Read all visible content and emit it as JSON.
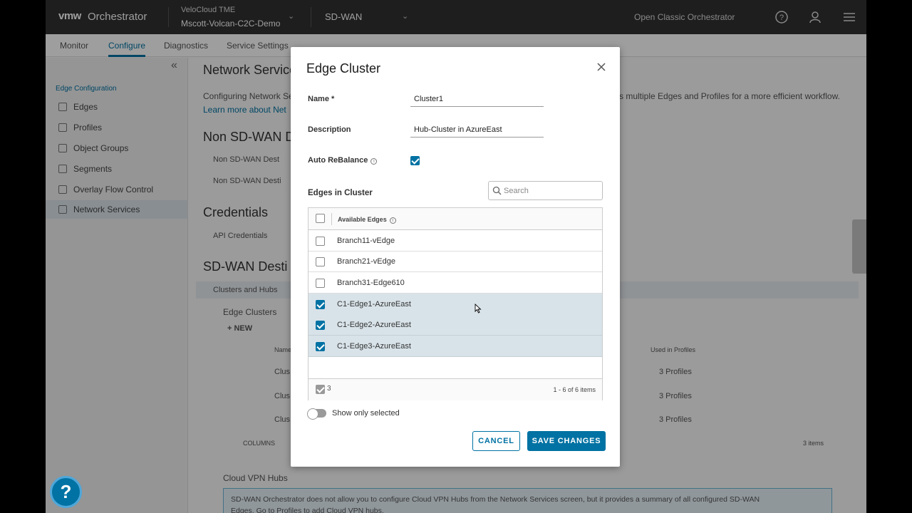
{
  "header": {
    "logo": "vmw",
    "app_name": "Orchestrator",
    "org_line1": "VeloCloud TME",
    "org_line2": "Mscott-Volcan-C2C-Demo",
    "product": "SD-WAN",
    "classic_link": "Open Classic Orchestrator"
  },
  "tabs": [
    "Monitor",
    "Configure",
    "Diagnostics",
    "Service Settings"
  ],
  "sidebar": {
    "section": "Edge Configuration",
    "items": [
      "Edges",
      "Profiles",
      "Object Groups",
      "Segments",
      "Overlay Flow Control",
      "Network Services"
    ]
  },
  "main": {
    "title": "Network Services",
    "desc_left": "Configuring Network Se",
    "desc_right": "s multiple Edges and Profiles for a more efficient workflow.",
    "learn_more": "Learn more about Net",
    "non_sdwan_title": "Non SD-WAN D",
    "non_sdwan_row1": "Non SD-WAN Dest",
    "non_sdwan_row2": "Non SD-WAN Desti",
    "credentials_title": "Credentials",
    "api_credentials": "API Credentials",
    "sdwan_dest_title": "SD-WAN Desti",
    "clusters_hubs": "Clusters and Hubs",
    "edge_clusters": "Edge Clusters",
    "new_btn": "+ NEW",
    "col_name": "Name",
    "col_used": "Used in Profiles",
    "row_names": [
      "Clus",
      "Clus",
      "Clus"
    ],
    "row_used": [
      "3 Profiles",
      "3 Profiles",
      "3 Profiles"
    ],
    "columns_btn": "COLUMNS",
    "items_count": "3 items",
    "cloud_vpn_title": "Cloud VPN Hubs",
    "cloud_vpn_note_1": "SD-WAN Orchestrator does not allow you to configure Cloud VPN Hubs from the Network Services screen, but it provides a summary of all configured SD-WAN",
    "cloud_vpn_note_2": "Edges. Go to Profiles to add Cloud VPN hubs."
  },
  "modal": {
    "title": "Edge Cluster",
    "name_label": "Name *",
    "name_value": "Cluster1",
    "description_label": "Description",
    "description_value": "Hub-Cluster in AzureEast",
    "auto_rebalance_label": "Auto ReBalance",
    "auto_rebalance_checked": true,
    "edges_label": "Edges in Cluster",
    "search_placeholder": "Search",
    "grid_header": "Available Edges",
    "edges": [
      {
        "name": "Branch11-vEdge",
        "selected": false
      },
      {
        "name": "Branch21-vEdge",
        "selected": false
      },
      {
        "name": "Branch31-Edge610",
        "selected": false
      },
      {
        "name": "C1-Edge1-AzureEast",
        "selected": true
      },
      {
        "name": "C1-Edge2-AzureEast",
        "selected": true
      },
      {
        "name": "C1-Edge3-AzureEast",
        "selected": true
      }
    ],
    "selected_count": "3",
    "pagination": "1 - 6 of 6 items",
    "show_only_selected": "Show only selected",
    "cancel_label": "CANCEL",
    "save_label": "SAVE CHANGES"
  },
  "help_label": "?",
  "colors": {
    "accent": "#0072a3",
    "header_bg": "#313131",
    "selected_row": "#d8e3e9"
  },
  "icons": [
    "close-icon",
    "search-icon",
    "info-icon",
    "help-icon",
    "user-icon",
    "menu-icon",
    "chevron-down-icon"
  ]
}
